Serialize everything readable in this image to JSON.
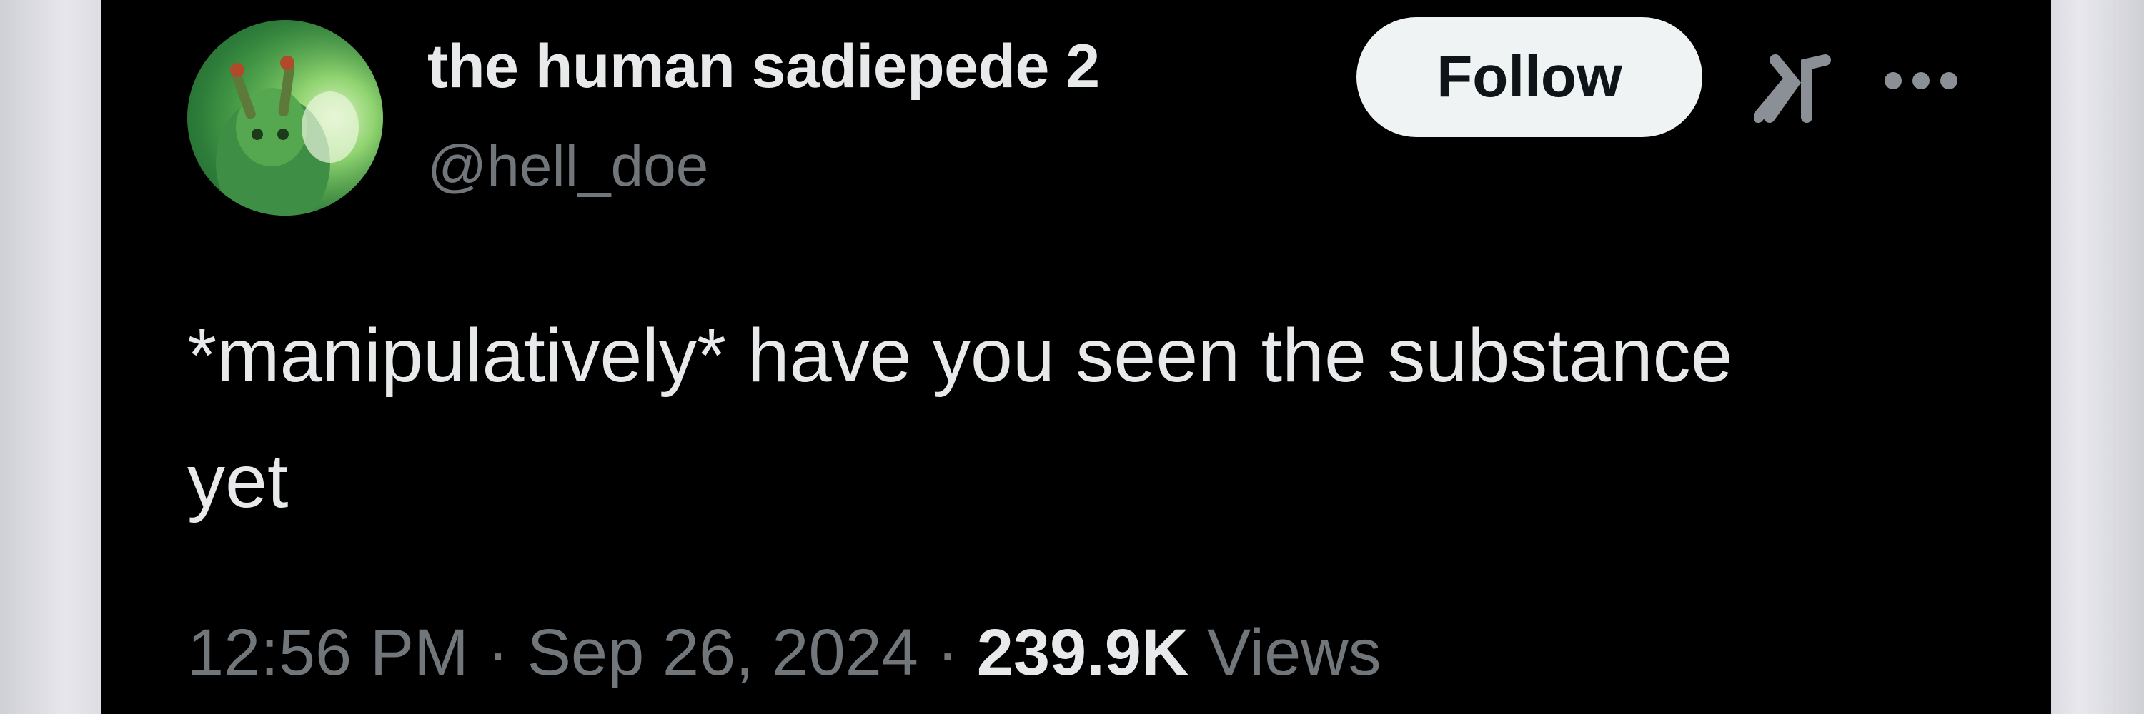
{
  "tweet": {
    "author": {
      "display_name": "the human sadiepede 2",
      "handle": "@hell_doe",
      "avatar_icon": "caterpillar-avatar"
    },
    "follow_label": "Follow",
    "text_line1": "*manipulatively* have you seen the substance",
    "text_line2": "yet",
    "time": "12:56 PM",
    "separator1": " · ",
    "date": "Sep 26, 2024",
    "separator2": " · ",
    "views_count": "239.9K",
    "views_label": " Views",
    "icons": [
      "grok-icon",
      "more-options-icon"
    ]
  },
  "colors": {
    "background": "#000000",
    "text_primary": "#e7e9ea",
    "text_secondary": "#71767b",
    "follow_button_bg": "#eff3f4",
    "follow_button_text": "#0f1419"
  }
}
